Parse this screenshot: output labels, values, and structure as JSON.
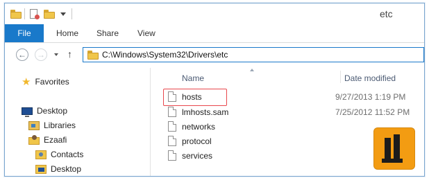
{
  "window": {
    "title": "etc"
  },
  "ribbon": {
    "tabs": [
      "File",
      "Home",
      "Share",
      "View"
    ]
  },
  "address": {
    "path": "C:\\Windows\\System32\\Drivers\\etc"
  },
  "nav_pane": {
    "items": [
      {
        "label": "Favorites",
        "icon": "star-icon"
      },
      {
        "label": "Desktop",
        "icon": "desktop-icon"
      },
      {
        "label": "Libraries",
        "icon": "libraries-icon"
      },
      {
        "label": "Ezaafi",
        "icon": "user-folder-icon"
      },
      {
        "label": "Contacts",
        "icon": "contacts-folder-icon"
      },
      {
        "label": "Desktop",
        "icon": "desktop-folder-icon"
      }
    ]
  },
  "file_list": {
    "columns": {
      "name": "Name",
      "date_modified": "Date modified"
    },
    "rows": [
      {
        "name": "hosts",
        "date": "9/27/2013 1:19 PM",
        "highlighted": true
      },
      {
        "name": "lmhosts.sam",
        "date": "7/25/2012 11:52 PM",
        "highlighted": false
      },
      {
        "name": "networks",
        "date": "",
        "highlighted": false
      },
      {
        "name": "protocol",
        "date": "",
        "highlighted": false
      },
      {
        "name": "services",
        "date": "",
        "highlighted": false
      }
    ]
  },
  "colors": {
    "accent": "#1979ca",
    "highlight": "#e8474c",
    "logo": "#f39c12"
  }
}
